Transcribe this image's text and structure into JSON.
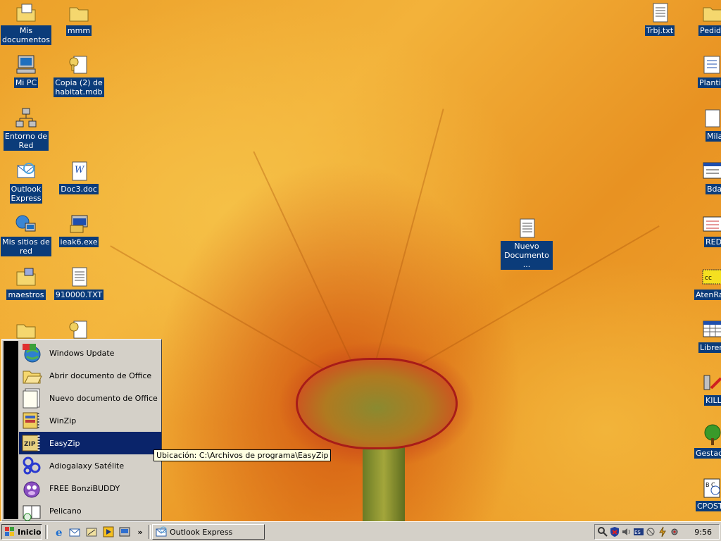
{
  "desktop_icons_left": [
    {
      "name": "mis-documentos-icon",
      "label": "Mis\ndocumentos"
    },
    {
      "name": "mi-pc-icon",
      "label": "Mi PC"
    },
    {
      "name": "entorno-de-red-icon",
      "label": "Entorno de\nRed"
    },
    {
      "name": "outlook-express-icon",
      "label": "Outlook\nExpress"
    },
    {
      "name": "mis-sitios-de-red-icon",
      "label": "Mis sitios de\nred"
    },
    {
      "name": "maestros-icon",
      "label": "maestros"
    },
    {
      "name": "mmm-icon",
      "label": "mmm"
    },
    {
      "name": "copia-habitat-icon",
      "label": "Copia (2) de\nhabitat.mdb"
    },
    {
      "name": "doc3-icon",
      "label": "Doc3.doc"
    },
    {
      "name": "ieak6-icon",
      "label": "ieak6.exe"
    },
    {
      "name": "txt-910000-icon",
      "label": "910000.TXT"
    },
    {
      "name": "nuevo-documento-icon",
      "label": "Nuevo\nDocumento ..."
    }
  ],
  "desktop_icons_right": [
    {
      "name": "trbj-txt-icon",
      "label": "Trbj.txt"
    },
    {
      "name": "pedidos-icon",
      "label": "Pedido"
    },
    {
      "name": "plantilla-icon",
      "label": "Plantilla"
    },
    {
      "name": "mila-icon",
      "label": "Mila"
    },
    {
      "name": "bda-icon",
      "label": "Bda"
    },
    {
      "name": "red-icon",
      "label": "RED"
    },
    {
      "name": "atenraz-icon",
      "label": "AtenRaz"
    },
    {
      "name": "libreria-icon",
      "label": "Libreri"
    },
    {
      "name": "kill-icon",
      "label": "KILL"
    },
    {
      "name": "gestador-icon",
      "label": "Gestad"
    },
    {
      "name": "cpost-icon",
      "label": "CPOST"
    }
  ],
  "start_menu": {
    "items": [
      {
        "label": "Windows Update",
        "icon": "windows-update-icon"
      },
      {
        "label": "Abrir documento de Office",
        "icon": "open-folder-icon"
      },
      {
        "label": "Nuevo documento de Office",
        "icon": "new-document-icon"
      },
      {
        "label": "WinZip",
        "icon": "winzip-icon"
      },
      {
        "label": "EasyZip",
        "icon": "easyzip-icon",
        "selected": true
      },
      {
        "label": "Adiogalaxy Satélite",
        "icon": "adiogalaxy-icon"
      },
      {
        "label": "FREE BonziBUDDY",
        "icon": "bonzibuddy-icon"
      },
      {
        "label": "Pelicano",
        "icon": "pelicano-icon"
      }
    ]
  },
  "tooltip": "Ubicación: C:\\Archivos de programa\\EasyZip",
  "taskbar": {
    "start_label": "Inicio",
    "quick_launch_more": "»",
    "task_label": "Outlook Express",
    "clock": "9:56"
  },
  "colors": {
    "selection": "#0a246a",
    "icon_label_bg": "#0b3c7a",
    "taskbar": "#d4d0c8",
    "tooltip_bg": "#ffffe1"
  }
}
